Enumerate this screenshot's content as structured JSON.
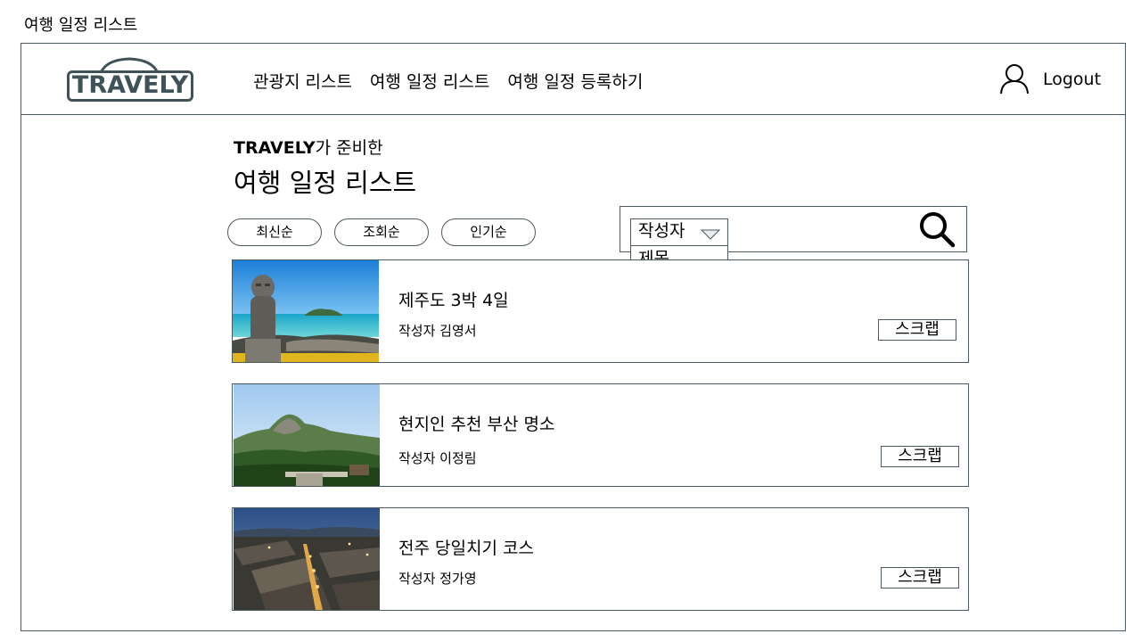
{
  "page_caption": "여행 일정 리스트",
  "header": {
    "logo_text": "TRAVELY",
    "nav": [
      "관광지 리스트",
      "여행 일정 리스트",
      "여행 일정 등록하기"
    ],
    "logout_label": "Logout"
  },
  "main": {
    "subtitle_brand": "TRAVELY",
    "subtitle_rest": "가 준비한",
    "title": "여행 일정 리스트",
    "filters": [
      "최신순",
      "조회순",
      "인기순"
    ],
    "search": {
      "selected": "작성자",
      "options": [
        "제목"
      ]
    },
    "scrap_label": "스크랩",
    "cards": [
      {
        "title": "제주도 3박 4일",
        "author": "작성자 김영서"
      },
      {
        "title": "현지인 추천 부산 명소",
        "author": "작성자 이정림"
      },
      {
        "title": "전주 당일치기 코스",
        "author": "작성자 정가영"
      }
    ]
  },
  "colors": {
    "border": "#4a5a60",
    "logo": "#3e5257"
  },
  "icons": [
    "user-icon",
    "search-icon",
    "dropdown-caret-icon"
  ]
}
